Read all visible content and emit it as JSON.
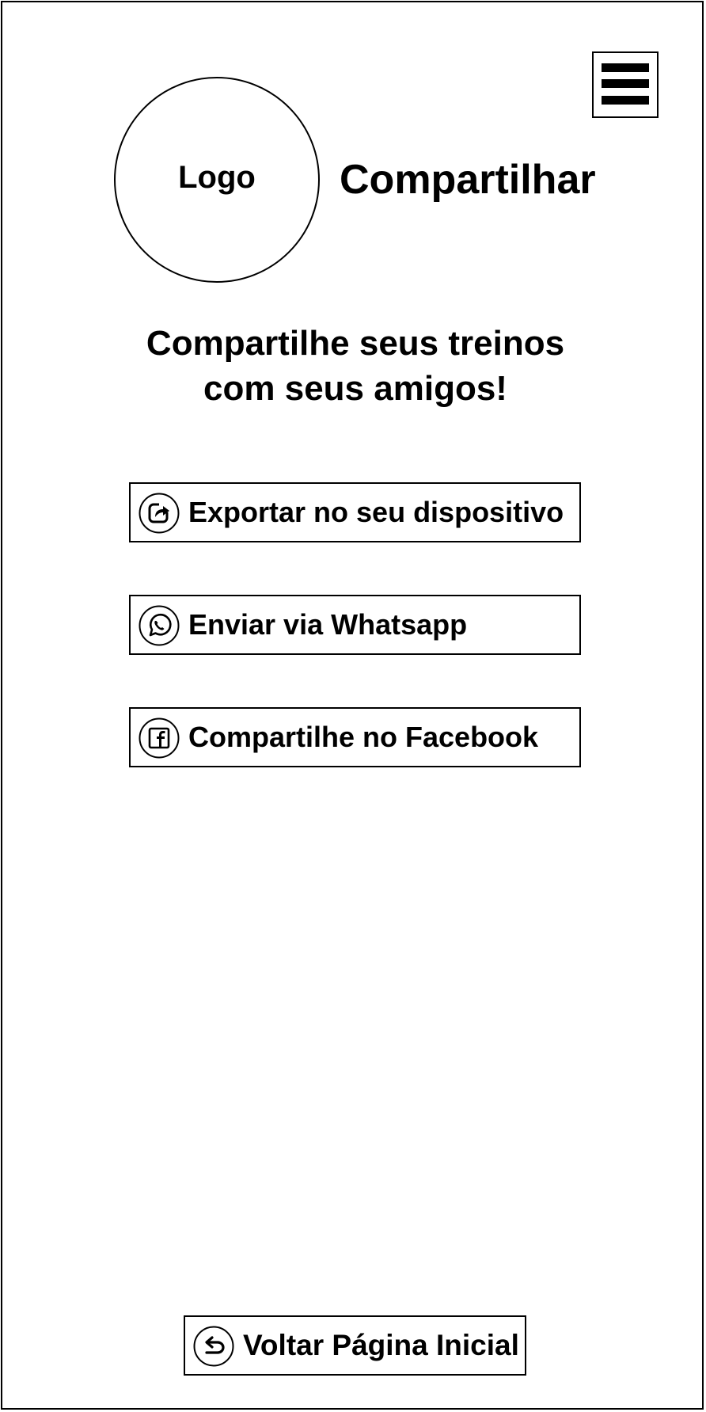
{
  "header": {
    "logo_text": "Logo",
    "title": "Compartilhar",
    "menu_icon": "hamburger-menu-icon"
  },
  "intro": {
    "line1": "Compartilhe seus treinos",
    "line2": "com seus amigos!"
  },
  "share_options": [
    {
      "label": "Exportar no seu dispositivo",
      "icon": "share-export-icon"
    },
    {
      "label": "Enviar via Whatsapp",
      "icon": "whatsapp-icon"
    },
    {
      "label": "Compartilhe no Facebook",
      "icon": "facebook-icon"
    }
  ],
  "footer": {
    "back_label": "Voltar Página Inicial",
    "back_icon": "return-arrow-icon"
  },
  "colors": {
    "line": "#000000",
    "background": "#ffffff"
  }
}
